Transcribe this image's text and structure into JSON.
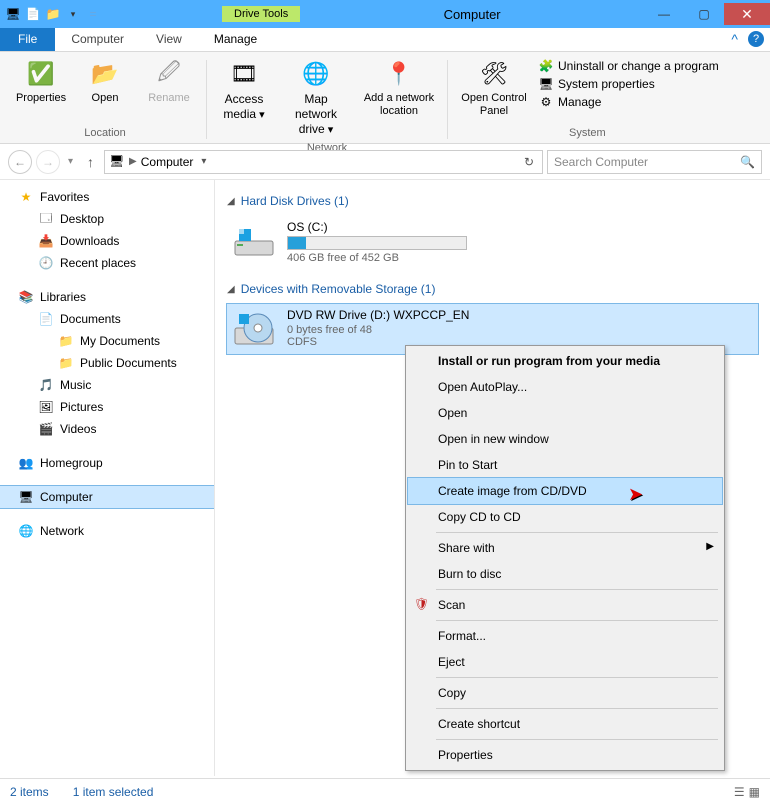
{
  "window": {
    "title": "Computer",
    "drive_tools": "Drive Tools"
  },
  "tabs": {
    "file": "File",
    "computer": "Computer",
    "view": "View",
    "manage": "Manage"
  },
  "ribbon": {
    "location": {
      "label": "Location",
      "properties": "Properties",
      "open": "Open",
      "rename": "Rename"
    },
    "network": {
      "label": "Network",
      "access_media": "Access media",
      "map_drive": "Map network drive",
      "add_location": "Add a network location"
    },
    "system": {
      "label": "System",
      "open_cp": "Open Control Panel",
      "uninstall": "Uninstall or change a program",
      "sys_props": "System properties",
      "manage": "Manage"
    }
  },
  "nav": {
    "location": "Computer",
    "search_placeholder": "Search Computer"
  },
  "sidebar": {
    "favorites": "Favorites",
    "desktop": "Desktop",
    "downloads": "Downloads",
    "recent": "Recent places",
    "libraries": "Libraries",
    "documents": "Documents",
    "my_documents": "My Documents",
    "public_documents": "Public Documents",
    "music": "Music",
    "pictures": "Pictures",
    "videos": "Videos",
    "homegroup": "Homegroup",
    "computer": "Computer",
    "network": "Network"
  },
  "main": {
    "hdd_header": "Hard Disk Drives (1)",
    "removable_header": "Devices with Removable Storage (1)",
    "os_drive": {
      "name": "OS (C:)",
      "free": "406 GB free of 452 GB",
      "fill_pct": 10
    },
    "dvd_drive": {
      "name": "DVD RW Drive (D:) WXPCCP_EN",
      "free": "0 bytes free of 48",
      "fs": "CDFS"
    }
  },
  "context_menu": {
    "install": "Install or run program from your media",
    "autoplay": "Open AutoPlay...",
    "open": "Open",
    "open_new": "Open in new window",
    "pin": "Pin to Start",
    "create_image": "Create image from CD/DVD",
    "copy_cd": "Copy CD to CD",
    "share_with": "Share with",
    "burn": "Burn to disc",
    "scan": "Scan",
    "format": "Format...",
    "eject": "Eject",
    "copy": "Copy",
    "shortcut": "Create shortcut",
    "properties": "Properties"
  },
  "status": {
    "items": "2 items",
    "selected": "1 item selected"
  }
}
